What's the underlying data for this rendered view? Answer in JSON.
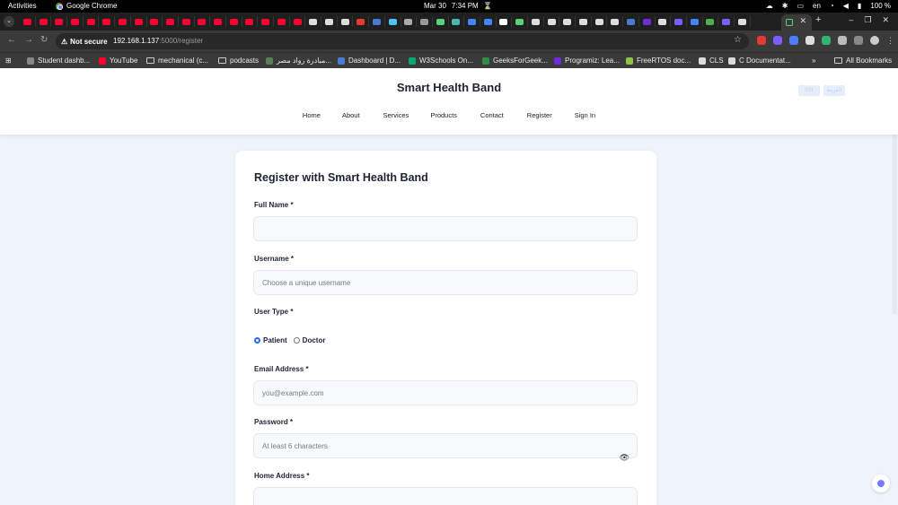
{
  "os_bar": {
    "activities": "Activities",
    "app_name": "Google Chrome",
    "date": "Mar 30",
    "time": "7:34 PM",
    "lang": "en",
    "battery": "100 %"
  },
  "browser": {
    "security_label": "Not secure",
    "url_host": "192.168.1.137",
    "url_path": ":5000/register",
    "bookmarks": [
      {
        "label": "Student dashb...",
        "icon": "student-icon",
        "color": "#888888"
      },
      {
        "label": "YouTube",
        "icon": "youtube-icon",
        "color": "#ff0033"
      },
      {
        "label": "mechanical (c...",
        "icon": "folder-icon",
        "color": ""
      },
      {
        "label": "podcasts",
        "icon": "folder-icon",
        "color": ""
      },
      {
        "label": "مبادرة رواد مصر...",
        "icon": "site-icon",
        "color": "#5a7d5a"
      },
      {
        "label": "Dashboard | D...",
        "icon": "dashboard-icon",
        "color": "#4a7bd0"
      },
      {
        "label": "W3Schools On...",
        "icon": "w3schools-icon",
        "color": "#04aa6d"
      },
      {
        "label": "GeeksForGeek...",
        "icon": "gfg-icon",
        "color": "#2f8d46"
      },
      {
        "label": "Programiz: Lea...",
        "icon": "programiz-icon",
        "color": "#6d2bd9"
      },
      {
        "label": "FreeRTOS doc...",
        "icon": "freertos-icon",
        "color": "#8bc34a"
      },
      {
        "label": "CLS",
        "icon": "cls-icon",
        "color": "#dddddd"
      },
      {
        "label": "C Documentat...",
        "icon": "c-doc-icon",
        "color": "#dddddd"
      }
    ],
    "all_bookmarks": "All Bookmarks"
  },
  "site": {
    "brand": "Smart Health Band",
    "lang_en": "EN",
    "lang_ar": "العربية",
    "nav": [
      "Home",
      "About",
      "Services",
      "Products",
      "Contact",
      "Register",
      "Sign In"
    ]
  },
  "form": {
    "title": "Register with Smart Health Band",
    "full_name_label": "Full Name *",
    "full_name_placeholder": "",
    "username_label": "Username *",
    "username_placeholder": "Choose a unique username",
    "user_type_label": "User Type *",
    "user_type_options": [
      "Patient",
      "Doctor"
    ],
    "user_type_selected": "Patient",
    "email_label": "Email Address *",
    "email_placeholder": "you@example.com",
    "password_label": "Password *",
    "password_placeholder": "At least 6 characters",
    "address_label": "Home Address *",
    "address_placeholder": ""
  }
}
